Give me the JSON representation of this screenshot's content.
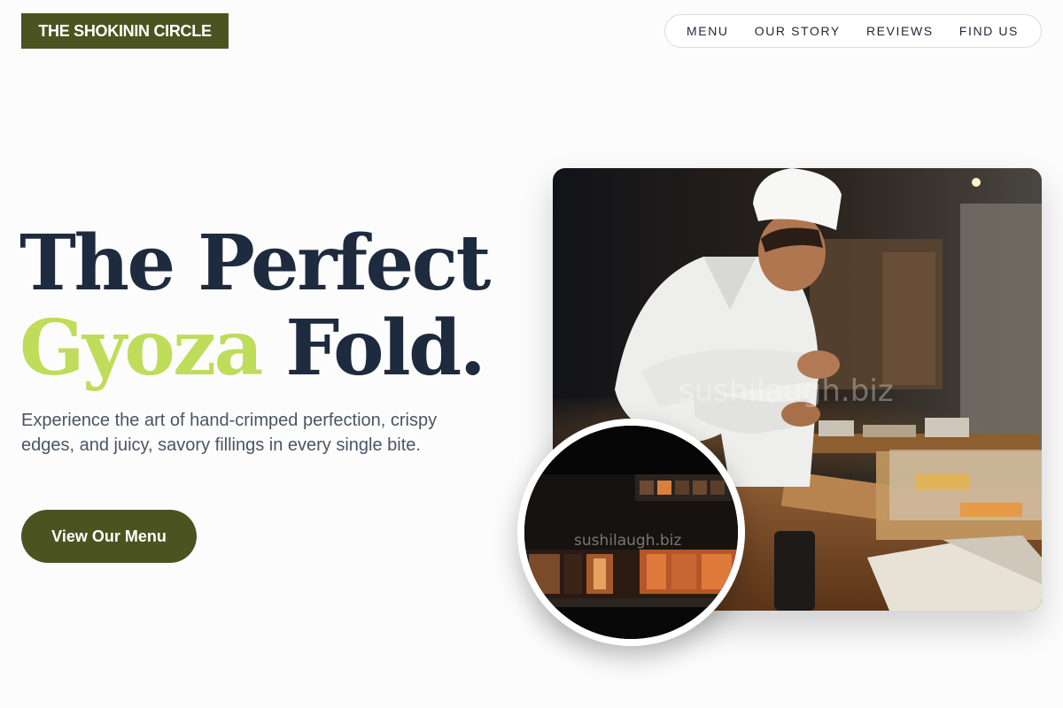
{
  "header": {
    "logo": "THE SHOKININ CIRCLE",
    "nav": [
      "MENU",
      "OUR STORY",
      "REVIEWS",
      "FIND US"
    ]
  },
  "hero": {
    "headline_line1": "The Perfect",
    "headline_accent": "Gyoza",
    "headline_rest": " Fold.",
    "subtitle": "Experience the art of hand-crimped perfection, crispy edges, and juicy, savory fillings in every single bite.",
    "cta_label": "View Our Menu"
  },
  "images": {
    "main_watermark": "sushilaugh.biz",
    "inset_watermark": "sushilaugh.biz"
  },
  "colors": {
    "brand": "#4b5320",
    "accent": "#bfdc5a",
    "heading": "#1e2a3d",
    "body_text": "#4b5563"
  }
}
